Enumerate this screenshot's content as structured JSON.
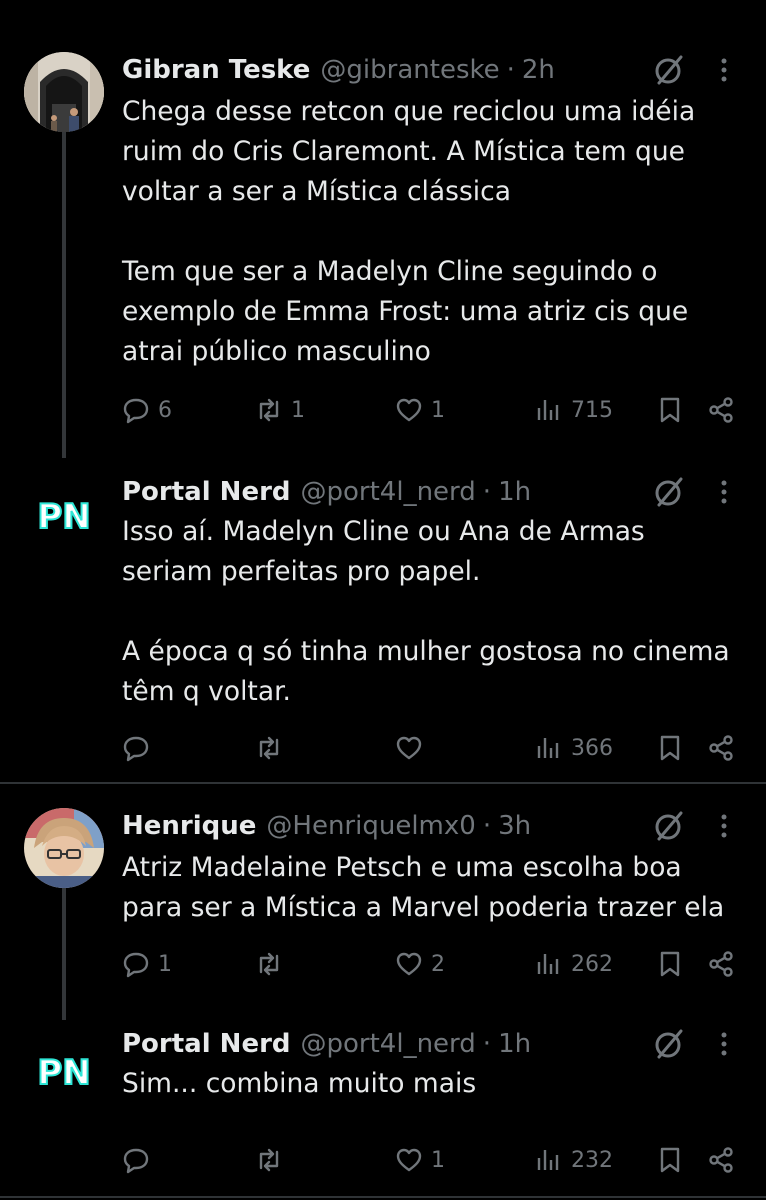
{
  "tweets": [
    {
      "name": "Gibran Teske",
      "handle": "@gibranteske",
      "sep": "·",
      "time": "2h",
      "text": "Chega desse retcon que reciclou uma idéia\nruim do Cris Claremont. A Mística tem que\nvoltar a ser a Mística clássica\n\nTem que ser a Madelyn Cline seguindo o\nexemplo de Emma Frost: uma atriz cis que\natrai público masculino",
      "replies": "6",
      "retweets": "1",
      "likes": "1",
      "views": "715"
    },
    {
      "name": "Portal Nerd",
      "handle": "@port4l_nerd",
      "sep": "·",
      "time": "1h",
      "text": "Isso aí. Madelyn Cline ou Ana de Armas\nseriam perfeitas pro papel.\n\nA época q só tinha mulher gostosa no cinema\ntêm q voltar.",
      "replies": "",
      "retweets": "",
      "likes": "",
      "views": "366"
    },
    {
      "name": "Henrique",
      "handle": "@Henriquelmx0",
      "sep": "·",
      "time": "3h",
      "text": "Atriz Madelaine Petsch e uma escolha boa\npara ser a Mística a Marvel poderia trazer ela",
      "replies": "1",
      "retweets": "",
      "likes": "2",
      "views": "262"
    },
    {
      "name": "Portal Nerd",
      "handle": "@port4l_nerd",
      "sep": "·",
      "time": "1h",
      "text": "Sim... combina muito mais",
      "replies": "",
      "retweets": "",
      "likes": "1",
      "views": "232"
    }
  ],
  "logo_text": "PN",
  "colors": {
    "background": "#000000",
    "text": "#e7e9ea",
    "muted": "#71767b",
    "thread_line": "#333639",
    "divider": "#2f3336",
    "logo_cyan": "#2ee6d6"
  },
  "icons": [
    "grok-icon",
    "more-icon",
    "reply-icon",
    "retweet-icon",
    "like-icon",
    "views-icon",
    "bookmark-icon",
    "share-icon"
  ]
}
